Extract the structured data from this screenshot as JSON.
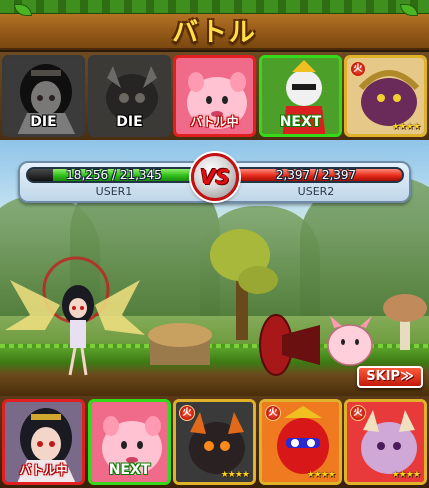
{
  "header": {
    "title": "バトル"
  },
  "enemy_cards": [
    {
      "status": "DIE",
      "stars": "",
      "name": "dark-haired-girl"
    },
    {
      "status": "DIE",
      "stars": "",
      "name": "brown-beast"
    },
    {
      "status": "バトル中",
      "stars": "",
      "name": "pink-blob"
    },
    {
      "status": "NEXT",
      "stars": "",
      "name": "red-armored-knight"
    },
    {
      "status": "",
      "stars": "★★★★",
      "name": "purple-dark-creature"
    }
  ],
  "hp": {
    "user1_text": "18,256 / 21,345",
    "user1_fraction": 0.855,
    "user1_name": "USER1",
    "user2_text": "2,397 / 2,397",
    "user2_fraction": 1.0,
    "user2_name": "USER2",
    "vs_label": "VS"
  },
  "skip_label": "SKIP≫",
  "player_cards": [
    {
      "status": "バトル中",
      "stars": "",
      "name": "dark-haired-girl"
    },
    {
      "status": "NEXT",
      "stars": "",
      "name": "pink-blob"
    },
    {
      "status": "",
      "stars": "★★★★",
      "name": "dark-horned-beast"
    },
    {
      "status": "",
      "stars": "★★★★",
      "name": "red-masked-warrior"
    },
    {
      "status": "",
      "stars": "★★★★",
      "name": "pink-horned-creature"
    }
  ]
}
